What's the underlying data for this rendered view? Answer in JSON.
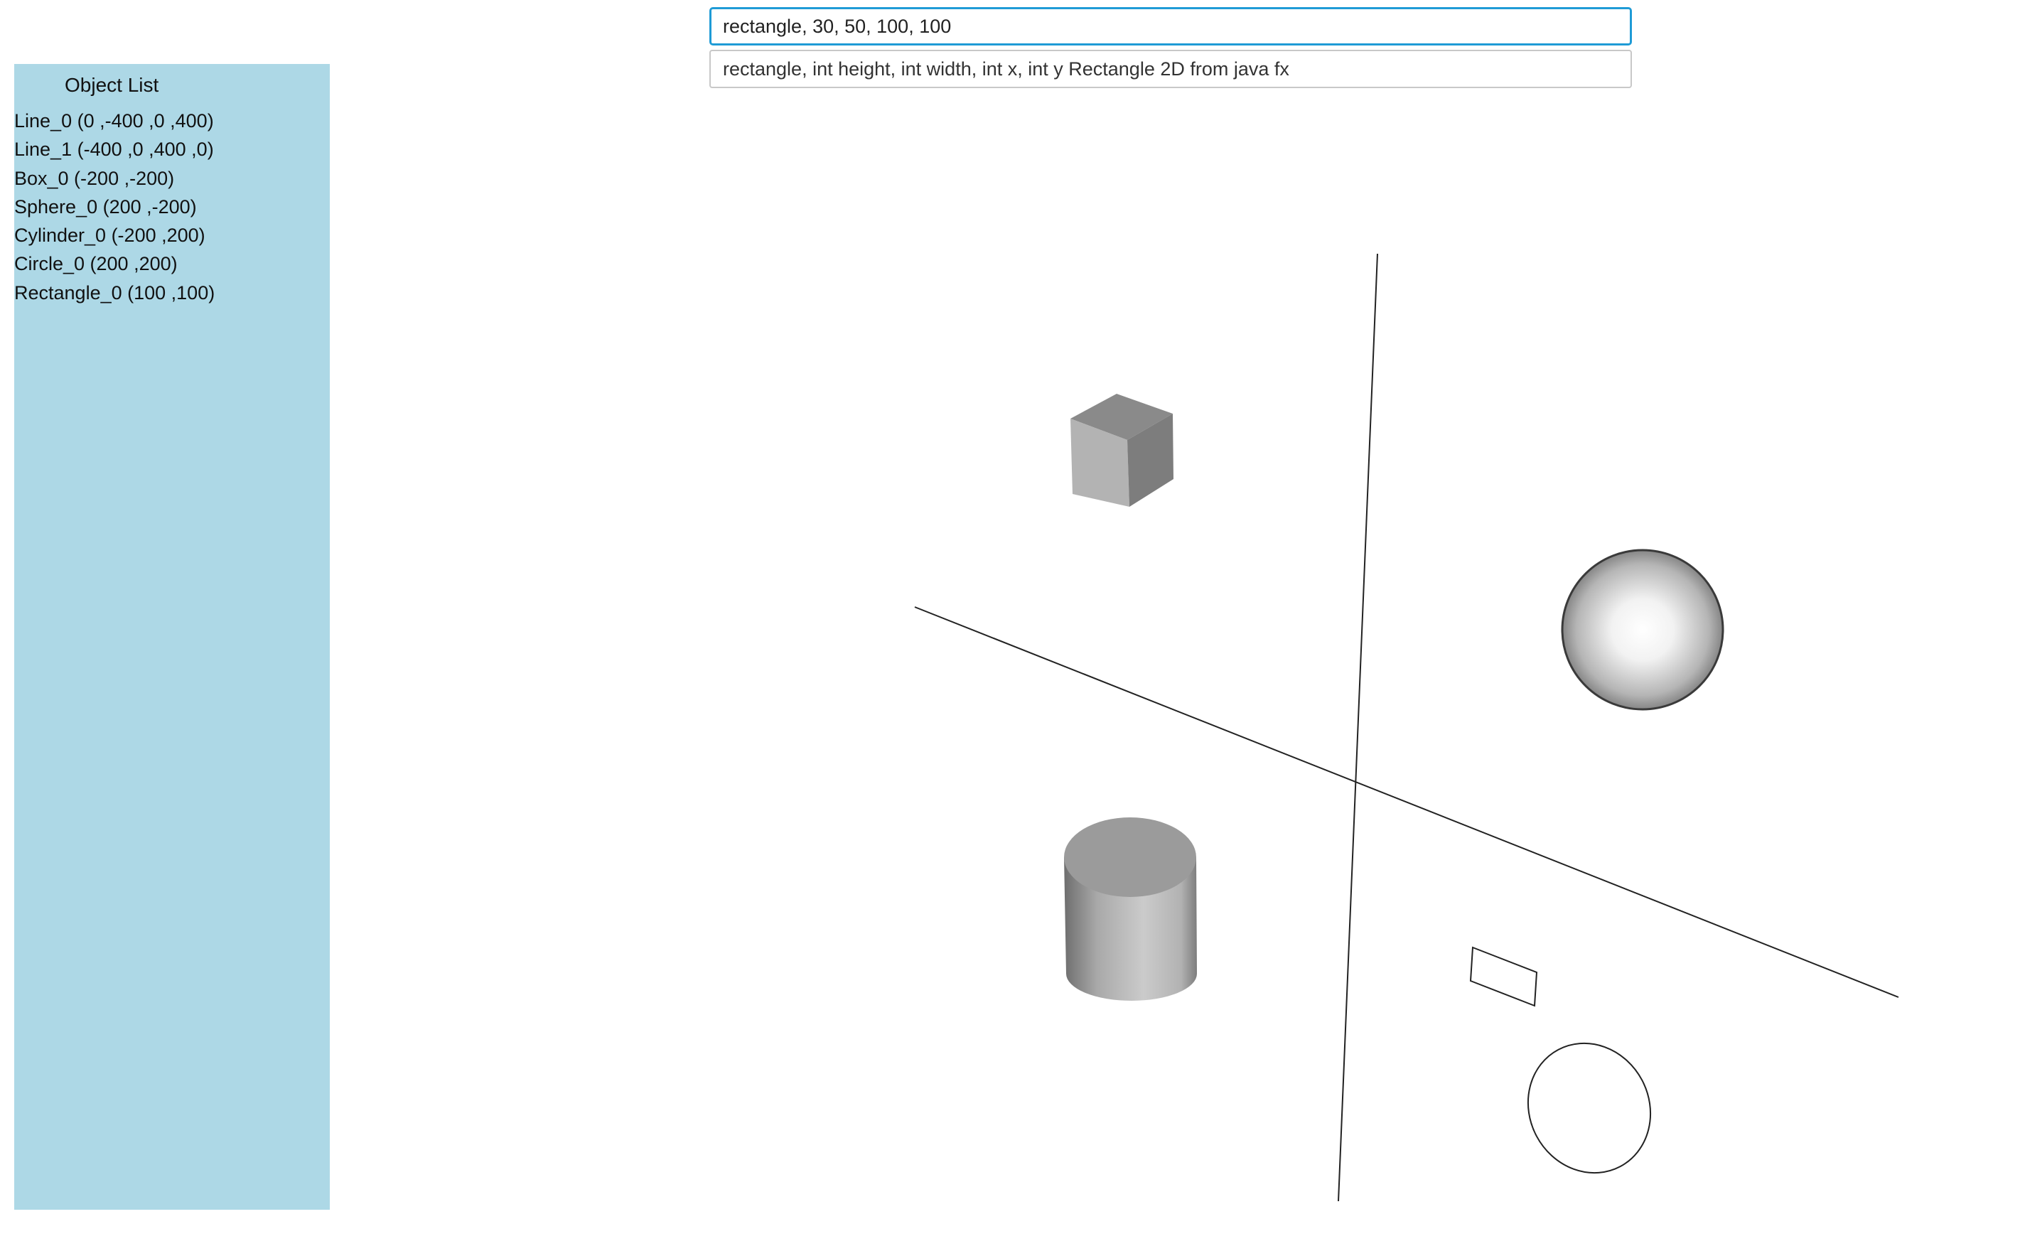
{
  "sidebar": {
    "title": "Object List",
    "items": [
      {
        "label": "Line_0 (0 ,-400 ,0 ,400)"
      },
      {
        "label": "Line_1 (-400 ,0 ,400 ,0)"
      },
      {
        "label": "Box_0 (-200 ,-200)"
      },
      {
        "label": "Sphere_0 (200 ,-200)"
      },
      {
        "label": "Cylinder_0 (-200 ,200)"
      },
      {
        "label": "Circle_0 (200 ,200)"
      },
      {
        "label": "Rectangle_0 (100 ,100)"
      }
    ],
    "background_color": "#add8e6"
  },
  "command": {
    "value": "rectangle, 30, 50, 100, 100",
    "hint": "rectangle, int height, int width, int x, int y Rectangle 2D from java fx"
  },
  "scene": {
    "objects": [
      "line",
      "line",
      "box",
      "sphere",
      "cylinder",
      "circle",
      "rectangle"
    ]
  },
  "colors": {
    "input_focus_border": "#1f9bd6",
    "line": "#222222"
  }
}
